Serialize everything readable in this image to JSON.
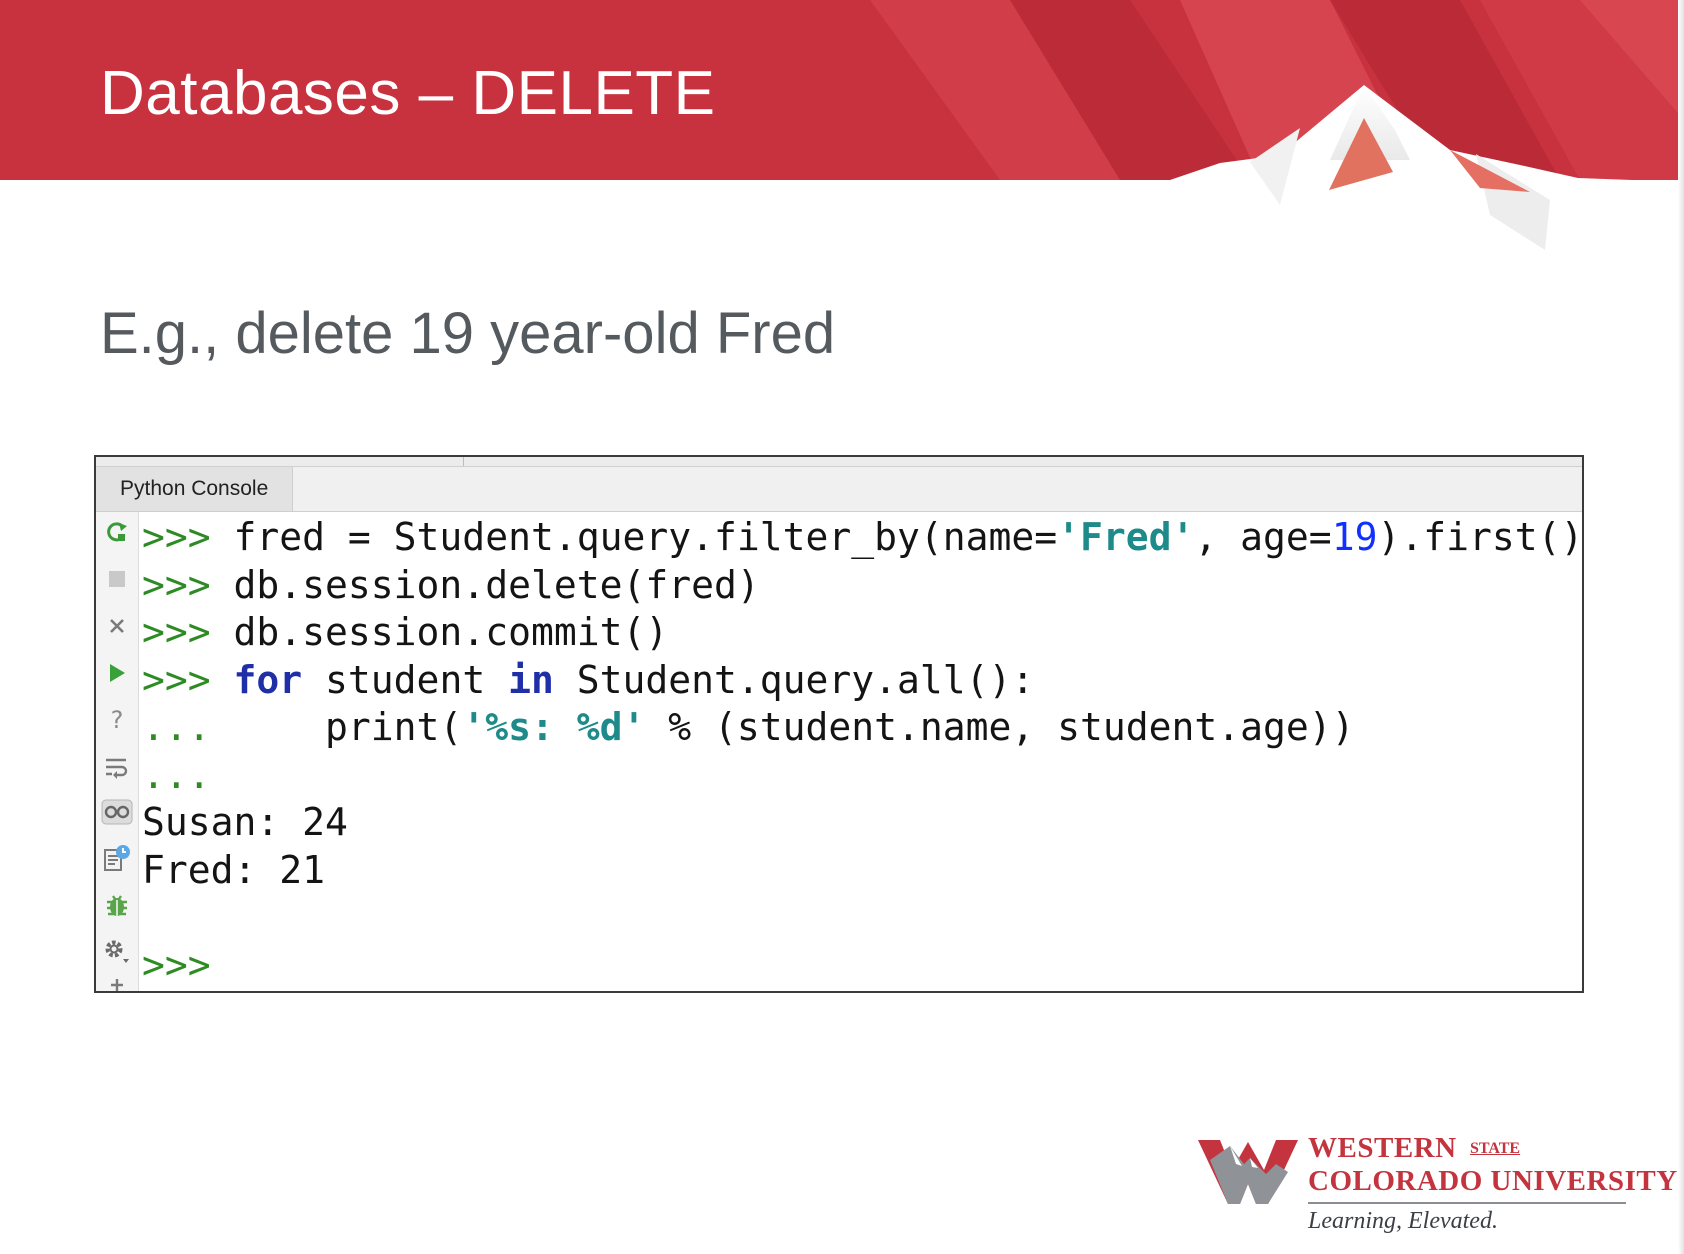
{
  "slide": {
    "title": "Databases – DELETE",
    "subtitle": "E.g., delete 19 year-old Fred"
  },
  "console": {
    "tab_label": "Python Console",
    "lines": [
      {
        "prompt": ">>>",
        "tokens": [
          {
            "t": "fred = Student.query.filter_by(name=",
            "c": "plain"
          },
          {
            "t": "'Fred'",
            "c": "str"
          },
          {
            "t": ", age=",
            "c": "plain"
          },
          {
            "t": "19",
            "c": "num"
          },
          {
            "t": ").first()",
            "c": "plain"
          }
        ]
      },
      {
        "prompt": ">>>",
        "tokens": [
          {
            "t": "db.session.delete(fred)",
            "c": "plain"
          }
        ]
      },
      {
        "prompt": ">>>",
        "tokens": [
          {
            "t": "db.session.commit()",
            "c": "plain"
          }
        ]
      },
      {
        "prompt": ">>>",
        "tokens": [
          {
            "t": "for",
            "c": "kw"
          },
          {
            "t": " student ",
            "c": "plain"
          },
          {
            "t": "in",
            "c": "kw"
          },
          {
            "t": " Student.query.all():",
            "c": "plain"
          }
        ]
      },
      {
        "prompt": "...",
        "tokens": [
          {
            "t": "    print(",
            "c": "plain"
          },
          {
            "t": "'%s: %d'",
            "c": "str"
          },
          {
            "t": " % (student.name, student.age))",
            "c": "plain"
          }
        ]
      },
      {
        "prompt": "...",
        "tokens": []
      },
      {
        "prompt": "",
        "tokens": [
          {
            "t": "Susan: 24",
            "c": "plain"
          }
        ]
      },
      {
        "prompt": "",
        "tokens": [
          {
            "t": "Fred: 21",
            "c": "plain"
          }
        ]
      },
      {
        "prompt": "",
        "tokens": []
      },
      {
        "prompt": ">>>",
        "tokens": []
      }
    ],
    "gutter_icons": [
      "rerun-icon",
      "stop-icon",
      "close-icon",
      "run-icon",
      "help-icon",
      "soft-wrap-icon",
      "variables-icon",
      "history-icon",
      "debug-icon",
      "settings-icon",
      "add-icon"
    ]
  },
  "logo": {
    "line1": "WESTERN",
    "state": "STATE",
    "line2": "COLORADO UNIVERSITY",
    "tagline": "Learning, Elevated."
  },
  "colors": {
    "banner_red": "#c8323f",
    "prompt_green": "#2e8b24",
    "keyword_blue": "#1f2fa8",
    "string_teal": "#1e8a8a",
    "number_blue": "#1030ff",
    "brand_red": "#c4343f"
  }
}
